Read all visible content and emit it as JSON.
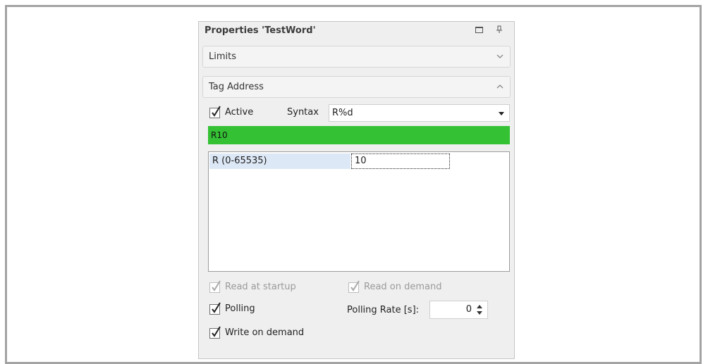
{
  "panel": {
    "title": "Properties 'TestWord'",
    "icons": [
      "maximize-icon",
      "pin-icon"
    ]
  },
  "sections": {
    "limits": {
      "label": "Limits",
      "state": "collapsed"
    },
    "tag_address": {
      "label": "Tag Address",
      "state": "expanded"
    }
  },
  "tag_address": {
    "active": {
      "label": "Active",
      "checked": true
    },
    "syntax": {
      "label": "Syntax",
      "value": "R%d"
    },
    "address_value": "R10",
    "address_color": "#34c234",
    "parameters": [
      {
        "name": "R (0-65535)",
        "value": "10"
      }
    ],
    "read_at_startup": {
      "label": "Read at startup",
      "checked": true,
      "enabled": false
    },
    "read_on_demand": {
      "label": "Read on demand",
      "checked": true,
      "enabled": false
    },
    "polling": {
      "label": "Polling",
      "checked": true
    },
    "polling_rate": {
      "label": "Polling Rate [s]:",
      "value": "0"
    },
    "write_on_demand": {
      "label": "Write on demand",
      "checked": true
    }
  }
}
